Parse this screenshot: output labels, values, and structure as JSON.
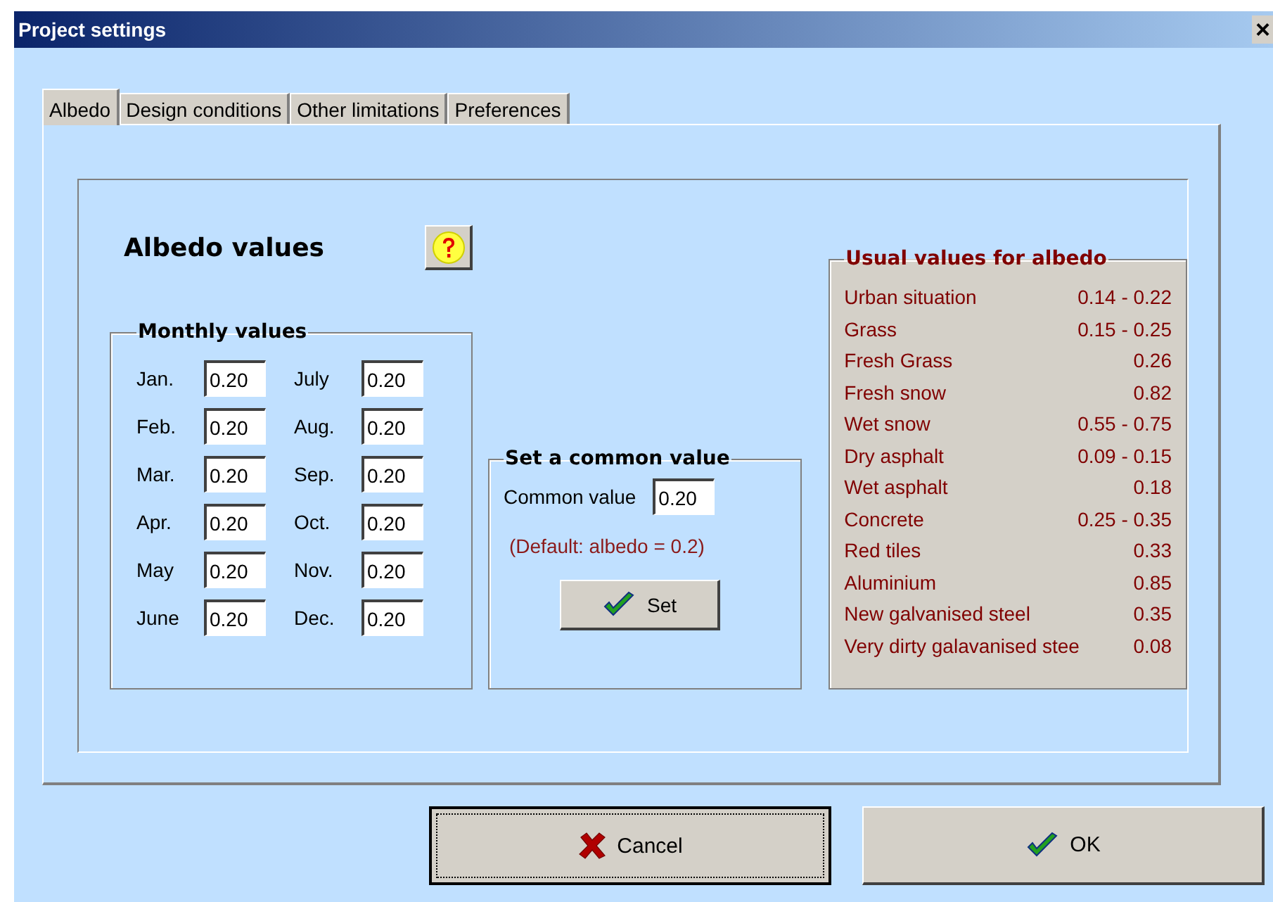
{
  "window": {
    "title": "Project settings",
    "close": "×"
  },
  "tabs": [
    {
      "label": "Albedo",
      "selected": true
    },
    {
      "label": "Design conditions",
      "selected": false
    },
    {
      "label": "Other limitations",
      "selected": false
    },
    {
      "label": "Preferences",
      "selected": false
    }
  ],
  "heading": "Albedo values",
  "monthly": {
    "title": "Monthly values",
    "months": [
      {
        "label": "Jan.",
        "value": "0.20"
      },
      {
        "label": "Feb.",
        "value": "0.20"
      },
      {
        "label": "Mar.",
        "value": "0.20"
      },
      {
        "label": "Apr.",
        "value": "0.20"
      },
      {
        "label": "May",
        "value": "0.20"
      },
      {
        "label": "June",
        "value": "0.20"
      },
      {
        "label": "July",
        "value": "0.20"
      },
      {
        "label": "Aug.",
        "value": "0.20"
      },
      {
        "label": "Sep.",
        "value": "0.20"
      },
      {
        "label": "Oct.",
        "value": "0.20"
      },
      {
        "label": "Nov.",
        "value": "0.20"
      },
      {
        "label": "Dec.",
        "value": "0.20"
      }
    ]
  },
  "common": {
    "title": "Set a common value",
    "label": "Common value",
    "value": "0.20",
    "note": "(Default: albedo = 0.2)",
    "button": "Set"
  },
  "usual": {
    "title": "Usual values for albedo",
    "items": [
      {
        "name": "Urban situation",
        "value": "0.14 - 0.22"
      },
      {
        "name": "Grass",
        "value": "0.15 - 0.25"
      },
      {
        "name": "Fresh Grass",
        "value": "0.26"
      },
      {
        "name": "Fresh snow",
        "value": "0.82"
      },
      {
        "name": "Wet snow",
        "value": "0.55 - 0.75"
      },
      {
        "name": "Dry asphalt",
        "value": "0.09 - 0.15"
      },
      {
        "name": "Wet asphalt",
        "value": "0.18"
      },
      {
        "name": "Concrete",
        "value": "0.25 - 0.35"
      },
      {
        "name": "Red tiles",
        "value": "0.33"
      },
      {
        "name": "Aluminium",
        "value": "0.85"
      },
      {
        "name": "New galvanised steel",
        "value": "0.35"
      },
      {
        "name": "Very dirty galavanised stee",
        "value": "0.08"
      }
    ]
  },
  "buttons": [
    {
      "label": "Cancel",
      "kind": "cancel",
      "focused": true
    },
    {
      "label": "OK",
      "kind": "ok",
      "focused": false
    }
  ]
}
